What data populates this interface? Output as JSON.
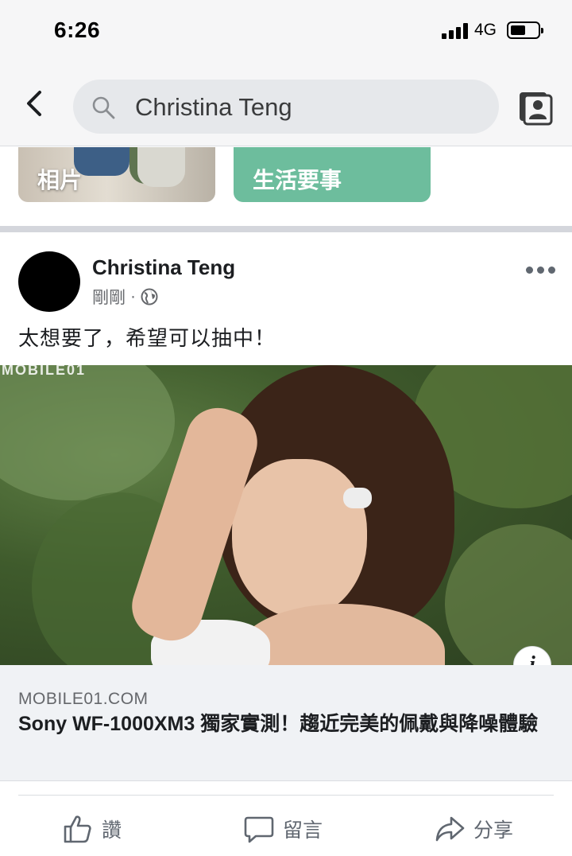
{
  "status_bar": {
    "time": "6:26",
    "network": "4G"
  },
  "header": {
    "search_value": "Christina Teng",
    "icons": {
      "back": "chevron-left-icon",
      "search": "search-icon",
      "profile": "profile-card-icon"
    }
  },
  "tiles": [
    {
      "label": "相片"
    },
    {
      "label": "生活要事"
    }
  ],
  "post": {
    "author": "Christina Teng",
    "time": "剛剛",
    "meta_separator": "·",
    "privacy_icon": "globe-icon",
    "text": "太想要了，希望可以抽中！",
    "photo_watermark": "MOBILE01",
    "link": {
      "domain": "MOBILE01.COM",
      "title": "Sony WF-1000XM3 獨家實測！趨近完美的佩戴與降噪體驗"
    }
  },
  "actions": [
    {
      "label": "讚",
      "icon": "thumbs-up-icon"
    },
    {
      "label": "留言",
      "icon": "comment-icon"
    },
    {
      "label": "分享",
      "icon": "share-icon"
    }
  ],
  "colors": {
    "header_bg": "#f6f6f7",
    "search_bg": "#e6e8eb",
    "tile_life": "#6dbd9d",
    "link_card_bg": "#f0f2f5",
    "secondary_text": "#65676b"
  }
}
